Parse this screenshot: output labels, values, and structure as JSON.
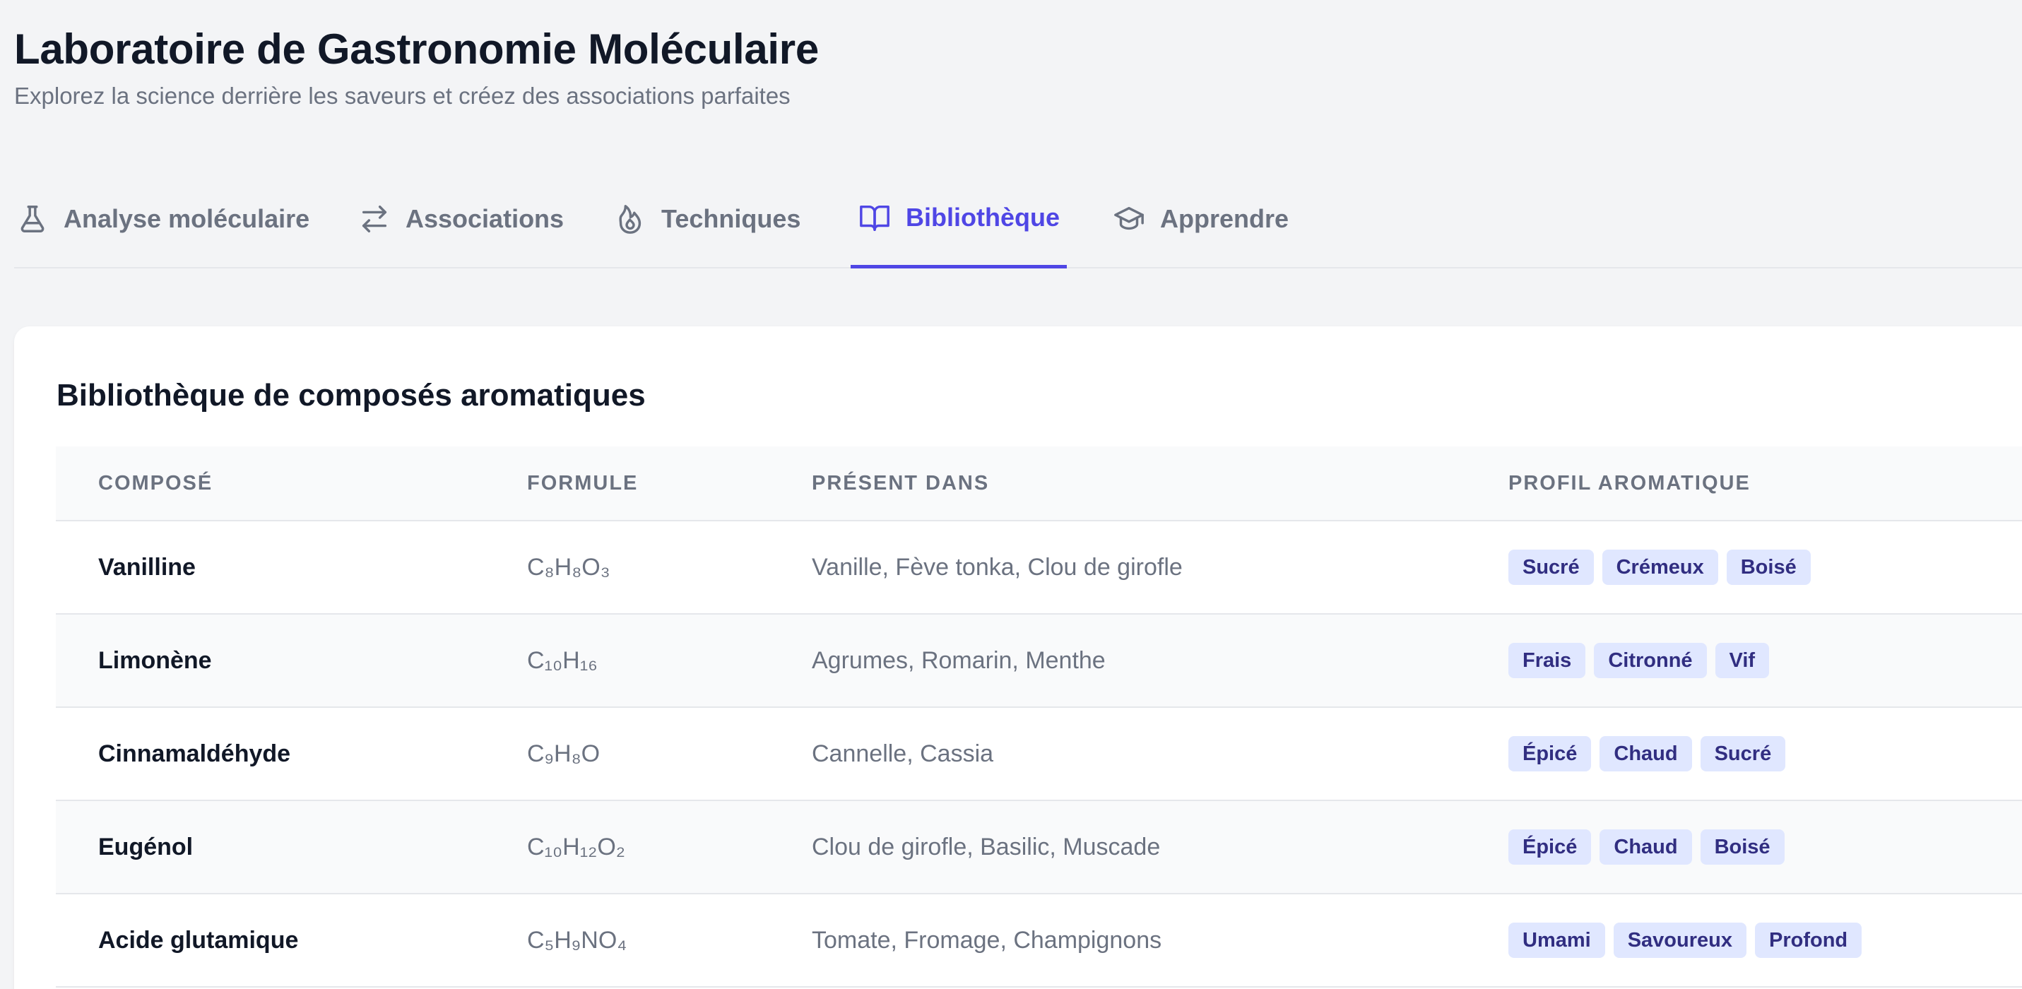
{
  "header": {
    "title": "Laboratoire de Gastronomie Moléculaire",
    "subtitle": "Explorez la science derrière les saveurs et créez des associations parfaites"
  },
  "tabs": [
    {
      "label": "Analyse moléculaire",
      "icon": "flask-icon",
      "active": false
    },
    {
      "label": "Associations",
      "icon": "arrows-left-right-icon",
      "active": false
    },
    {
      "label": "Techniques",
      "icon": "flame-icon",
      "active": false
    },
    {
      "label": "Bibliothèque",
      "icon": "book-open-icon",
      "active": true
    },
    {
      "label": "Apprendre",
      "icon": "graduation-cap-icon",
      "active": false
    }
  ],
  "library": {
    "title": "Bibliothèque de composés aromatiques",
    "columns": [
      "COMPOSÉ",
      "FORMULE",
      "PRÉSENT DANS",
      "PROFIL AROMATIQUE"
    ],
    "rows": [
      {
        "name": "Vanilline",
        "formula": "C₈H₈O₃",
        "present": "Vanille, Fève tonka, Clou de girofle",
        "tags": [
          "Sucré",
          "Crémeux",
          "Boisé"
        ]
      },
      {
        "name": "Limonène",
        "formula": "C₁₀H₁₆",
        "present": "Agrumes, Romarin, Menthe",
        "tags": [
          "Frais",
          "Citronné",
          "Vif"
        ]
      },
      {
        "name": "Cinnamaldéhyde",
        "formula": "C₉H₈O",
        "present": "Cannelle, Cassia",
        "tags": [
          "Épicé",
          "Chaud",
          "Sucré"
        ]
      },
      {
        "name": "Eugénol",
        "formula": "C₁₀H₁₂O₂",
        "present": "Clou de girofle, Basilic, Muscade",
        "tags": [
          "Épicé",
          "Chaud",
          "Boisé"
        ]
      },
      {
        "name": "Acide glutamique",
        "formula": "C₅H₉NO₄",
        "present": "Tomate, Fromage, Champignons",
        "tags": [
          "Umami",
          "Savoureux",
          "Profond"
        ]
      }
    ]
  },
  "colors": {
    "accent": "#4f46e5",
    "tag_bg": "#e0e7ff",
    "tag_text": "#312e81",
    "muted_text": "#6b7280"
  }
}
